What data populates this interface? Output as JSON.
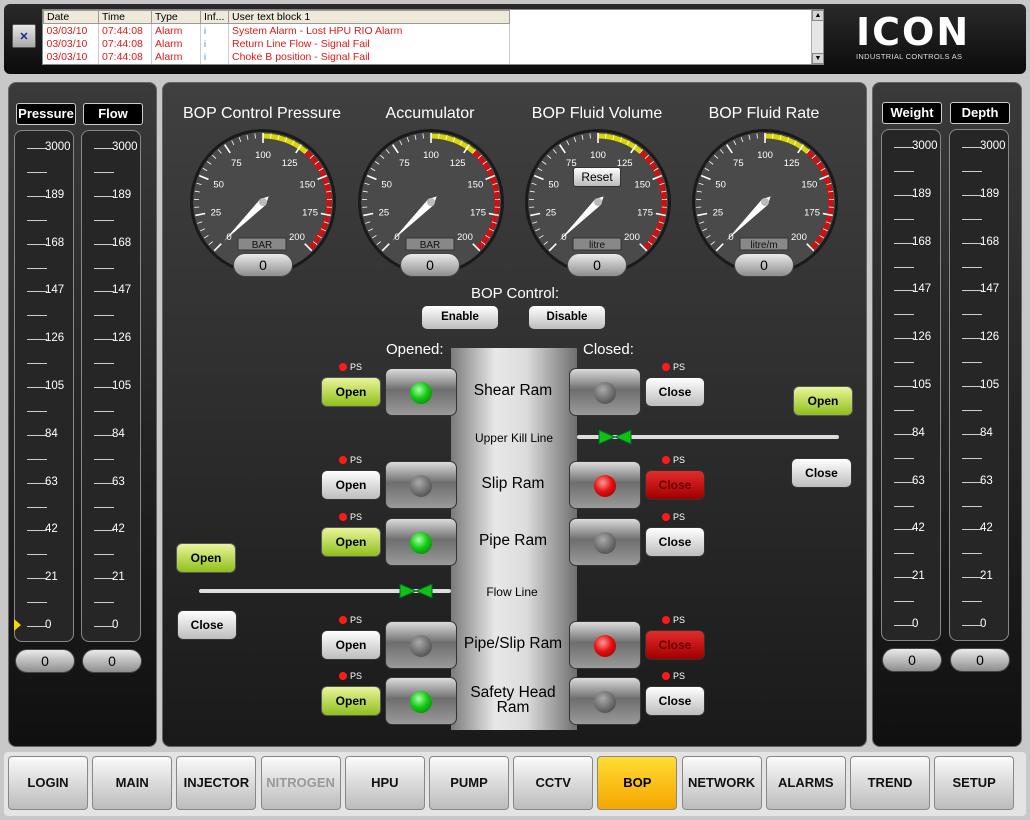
{
  "alarm_panel": {
    "ack_icon": "acknowledge-icon",
    "columns": [
      "Date",
      "Time",
      "Type",
      "Inf...",
      "User text block 1"
    ],
    "rows": [
      {
        "date": "03/03/10",
        "time": "07:44:08",
        "type": "Alarm",
        "info": "i",
        "text": "System Alarm - Lost HPU RIO Alarm"
      },
      {
        "date": "03/03/10",
        "time": "07:44:08",
        "type": "Alarm",
        "info": "i",
        "text": "Return Line Flow - Signal Fail"
      },
      {
        "date": "03/03/10",
        "time": "07:44:08",
        "type": "Alarm",
        "info": "i",
        "text": "Choke B position - Signal Fail"
      }
    ],
    "alarm_color": "#e01818"
  },
  "logo": {
    "brand": "ICON",
    "tagline": "INDUSTRIAL CONTROLS AS"
  },
  "left_scales": [
    {
      "label": "Pressure",
      "readout": "0"
    },
    {
      "label": "Flow",
      "readout": "0"
    }
  ],
  "right_scales": [
    {
      "label": "Weight",
      "readout": "0"
    },
    {
      "label": "Depth",
      "readout": "0"
    }
  ],
  "scale_ticks": [
    "3000",
    "189",
    "168",
    "147",
    "126",
    "105",
    "84",
    "63",
    "42",
    "21",
    "0"
  ],
  "gauges": [
    {
      "title": "BOP Control Pressure",
      "unit": "BAR",
      "readout": "0",
      "value": 0
    },
    {
      "title": "Accumulator",
      "unit": "BAR",
      "readout": "0",
      "value": 0
    },
    {
      "title": "BOP Fluid Volume",
      "unit": "litre",
      "readout": "0",
      "value": 0,
      "reset": "Reset"
    },
    {
      "title": "BOP Fluid Rate",
      "unit": "litre/m",
      "readout": "0",
      "value": 0
    }
  ],
  "gauge_ticks": [
    "0",
    "25",
    "50",
    "75",
    "100",
    "125",
    "150",
    "175",
    "200"
  ],
  "bop_control": {
    "label": "BOP Control:",
    "enable": "Enable",
    "disable": "Disable"
  },
  "opened_label": "Opened:",
  "closed_label": "Closed:",
  "ps": "PS",
  "rams": [
    {
      "name": "Shear Ram",
      "open": "Open",
      "close": "Close",
      "open_lamp": "green",
      "close_lamp": "grey",
      "close_red": false,
      "open_green": true
    },
    {
      "name": "Slip Ram",
      "open": "Open",
      "close": "Close",
      "open_lamp": "grey",
      "close_lamp": "red",
      "close_red": true,
      "open_green": false
    },
    {
      "name": "Pipe Ram",
      "open": "Open",
      "close": "Close",
      "open_lamp": "green",
      "close_lamp": "grey",
      "close_red": false,
      "open_green": true
    },
    {
      "name": "Pipe/Slip  Ram",
      "open": "Open",
      "close": "Close",
      "open_lamp": "grey",
      "close_lamp": "red",
      "close_red": true,
      "open_green": false
    },
    {
      "name": "Safety Head Ram",
      "open": "Open",
      "close": "Close",
      "open_lamp": "green",
      "close_lamp": "grey",
      "close_red": false,
      "open_green": true
    }
  ],
  "kill_line": {
    "label": "Upper Kill Line",
    "open": "Open",
    "close": "Close"
  },
  "flow_line": {
    "label": "Flow Line",
    "open": "Open",
    "close": "Close"
  },
  "nav": [
    {
      "label": "LOGIN",
      "state": "normal"
    },
    {
      "label": "MAIN",
      "state": "normal"
    },
    {
      "label": "INJECTOR",
      "state": "normal"
    },
    {
      "label": "NITROGEN",
      "state": "disabled"
    },
    {
      "label": "HPU",
      "state": "normal"
    },
    {
      "label": "PUMP",
      "state": "normal"
    },
    {
      "label": "CCTV",
      "state": "normal"
    },
    {
      "label": "BOP",
      "state": "active"
    },
    {
      "label": "NETWORK",
      "state": "normal"
    },
    {
      "label": "ALARMS",
      "state": "normal"
    },
    {
      "label": "TREND",
      "state": "normal"
    },
    {
      "label": "SETUP",
      "state": "normal"
    }
  ]
}
